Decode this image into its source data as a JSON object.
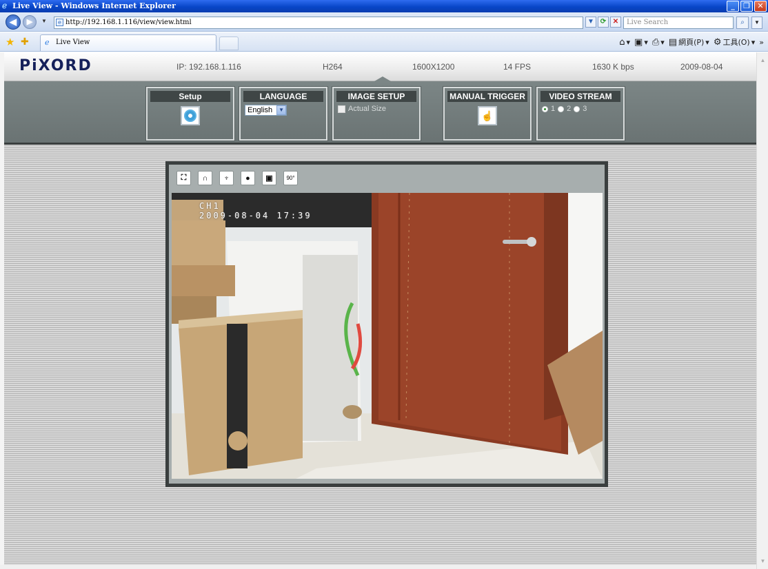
{
  "window": {
    "title": "Live View - Windows Internet Explorer",
    "minimize_glyph": "_",
    "maximize_glyph": "❐",
    "close_glyph": "✕"
  },
  "browser": {
    "url": "http://192.168.1.116/view/view.html",
    "search_placeholder": "Live Search",
    "tab_title": "Live View",
    "commands": {
      "page_label": "網頁(P)",
      "tools_label": "工具(O)"
    },
    "icons": [
      "back-icon",
      "forward-icon",
      "refresh-icon",
      "stop-icon",
      "search-icon",
      "favorites-star-icon",
      "add-favorite-icon",
      "home-icon",
      "feeds-icon",
      "print-icon",
      "page-icon",
      "tools-icon"
    ]
  },
  "header": {
    "logo": "PiXORD",
    "ip": "IP: 192.168.1.116",
    "codec": "H264",
    "resolution": "1600X1200",
    "fps": "14 FPS",
    "bitrate": "1630 K bps",
    "date": "2009-08-04"
  },
  "panels": {
    "setup": {
      "title": "Setup",
      "icon": "gear-icon"
    },
    "language": {
      "title": "LANGUAGE",
      "selected": "English",
      "options": [
        "English"
      ]
    },
    "image_setup": {
      "title": "IMAGE SETUP",
      "checkbox_label": "Actual Size",
      "checked": false
    },
    "manual_trigger": {
      "title": "MANUAL TRIGGER",
      "icon": "hand-pointer-icon"
    },
    "video_stream": {
      "title": "VIDEO STREAM",
      "options": [
        "1",
        "2",
        "3"
      ],
      "selected": "1"
    }
  },
  "viewer": {
    "buttons": [
      "fullscreen-icon",
      "headphones-icon",
      "microphone-icon",
      "record-icon",
      "snapshot-icon",
      "rotate-90-icon"
    ],
    "rotate_label": "90°",
    "osd_channel": "CH1",
    "osd_datetime": "2009-08-04 17:39"
  },
  "colors": {
    "toolbar_bg": "#6a7373",
    "panel_title_bg": "#3f4646",
    "logo_color": "#15205a",
    "xp_title_blue": "#0846c8"
  }
}
